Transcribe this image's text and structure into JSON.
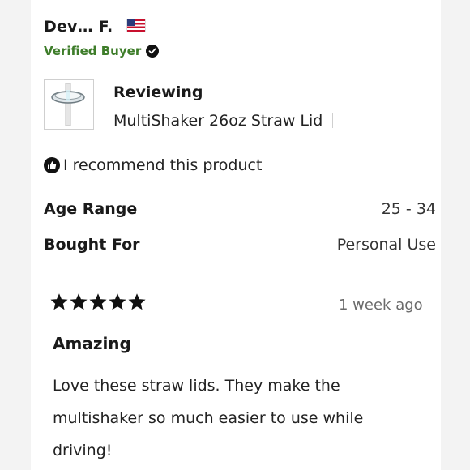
{
  "reviewer": {
    "name": "Dev… F.",
    "country_flag": "us-flag-icon",
    "verified_label": "Verified Buyer"
  },
  "product": {
    "reviewing_label": "Reviewing",
    "name": "MultiShaker 26oz Straw Lid",
    "thumbnail_icon": "straw-lid-icon"
  },
  "recommendation": {
    "icon": "thumbs-up-icon",
    "text": "I recommend this product"
  },
  "attributes": [
    {
      "label": "Age Range",
      "value": "25 - 34"
    },
    {
      "label": "Bought For",
      "value": "Personal Use"
    }
  ],
  "review": {
    "rating": 5,
    "max_rating": 5,
    "date": "1 week ago",
    "title": "Amazing",
    "body": "Love these straw lids. They make the multishaker so much easier to use while driving!"
  },
  "colors": {
    "verified_green": "#3e7d2a",
    "star_fill": "#111111"
  }
}
